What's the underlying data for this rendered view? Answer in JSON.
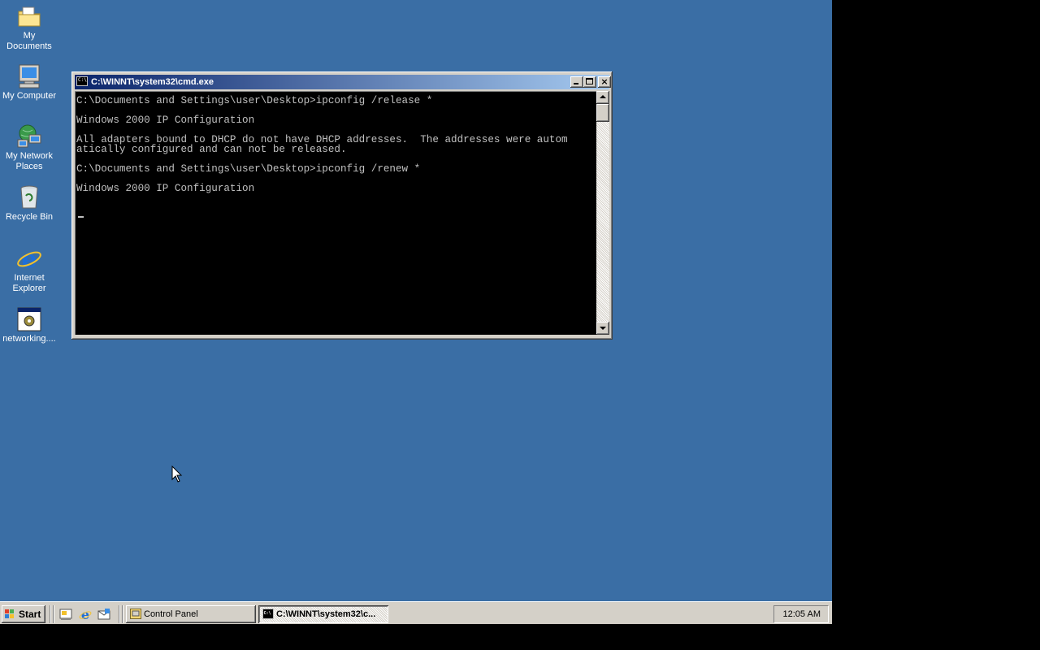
{
  "desktop": {
    "background": "#3a6ea5",
    "icons": [
      {
        "label": "My Documents",
        "icon": "folder-documents-icon"
      },
      {
        "label": "My Computer",
        "icon": "computer-icon"
      },
      {
        "label": "My Network Places",
        "icon": "network-places-icon"
      },
      {
        "label": "Recycle Bin",
        "icon": "recycle-bin-icon"
      },
      {
        "label": "Internet Explorer",
        "icon": "internet-explorer-icon"
      },
      {
        "label": "networking....",
        "icon": "shortcut-settings-icon"
      }
    ]
  },
  "window": {
    "title": "C:\\WINNT\\system32\\cmd.exe",
    "console_text": "C:\\Documents and Settings\\user\\Desktop>ipconfig /release *\n\nWindows 2000 IP Configuration\n\nAll adapters bound to DHCP do not have DHCP addresses.  The addresses were autom\natically configured and can not be released.\n\nC:\\Documents and Settings\\user\\Desktop>ipconfig /renew *\n\nWindows 2000 IP Configuration\n",
    "buttons": {
      "minimize": "minimize-icon",
      "maximize": "maximize-icon",
      "close": "×"
    }
  },
  "taskbar": {
    "start_label": "Start",
    "quick_launch": [
      "show-desktop-icon",
      "internet-explorer-icon",
      "outlook-express-icon"
    ],
    "tasks": [
      {
        "label": "Control Panel",
        "active": false
      },
      {
        "label": "C:\\WINNT\\system32\\c...",
        "active": true
      }
    ],
    "clock": "12:05 AM"
  }
}
